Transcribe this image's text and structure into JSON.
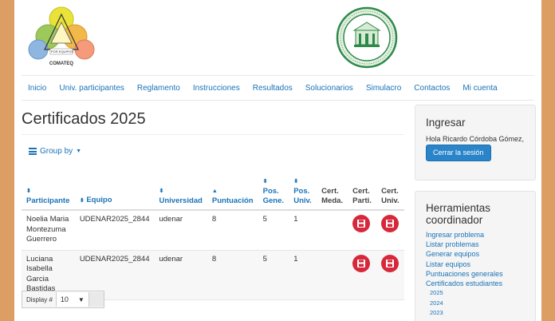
{
  "header": {
    "left_logo_caption": "COMATEQ",
    "left_logo_ring_text": "POR EQUIPOS"
  },
  "nav": {
    "items": [
      "Inicio",
      "Univ. participantes",
      "Reglamento",
      "Instrucciones",
      "Resultados",
      "Solucionarios",
      "Simulacro",
      "Contactos",
      "Mi cuenta"
    ]
  },
  "main": {
    "title": "Certificados 2025",
    "group_by_label": "Group by",
    "table": {
      "headers": {
        "participante": "Participante",
        "equipo": "Equipo",
        "universidad": "Universidad",
        "puntuacion": "Puntuación",
        "pos_gene_1": "Pos.",
        "pos_gene_2": "Gene.",
        "pos_univ_1": "Pos.",
        "pos_univ_2": "Univ.",
        "cert_meda_1": "Cert.",
        "cert_meda_2": "Meda.",
        "cert_parti_1": "Cert.",
        "cert_parti_2": "Parti.",
        "cert_univ_1": "Cert.",
        "cert_univ_2": "Univ."
      },
      "rows": [
        {
          "participante": "Noelia Maria Montezuma Guerrero",
          "equipo": "UDENAR2025_2844",
          "universidad": "udenar",
          "puntuacion": "8",
          "pos_gene": "5",
          "pos_univ": "1",
          "cert_meda": ""
        },
        {
          "participante": "Luciana Isabella Garcia Bastidas",
          "equipo": "UDENAR2025_2844",
          "universidad": "udenar",
          "puntuacion": "8",
          "pos_gene": "5",
          "pos_univ": "1",
          "cert_meda": ""
        }
      ]
    },
    "display": {
      "label": "Display #",
      "value": "10"
    }
  },
  "sidebar": {
    "login": {
      "title": "Ingresar",
      "greeting": "Hola Ricardo Córdoba Gómez,",
      "logout_label": "Cerrar la sesión"
    },
    "tools": {
      "title": "Herramientas coordinador",
      "items": [
        "Ingresar problema",
        "Listar problemas",
        "Generar equipos",
        "Listar equipos",
        "Puntuaciones generales",
        "Certificados estudiantes"
      ],
      "years": [
        "2025",
        "2024",
        "2023"
      ]
    }
  },
  "colors": {
    "link": "#1a73b8",
    "frame": "#dc9e63",
    "cert_button": "#d6283a",
    "logout_button": "#2a84c9"
  },
  "icons": {
    "sort": "sort-icon",
    "sort_active": "sort-up-icon",
    "group_by": "list-icon",
    "certificate": "save-icon"
  }
}
